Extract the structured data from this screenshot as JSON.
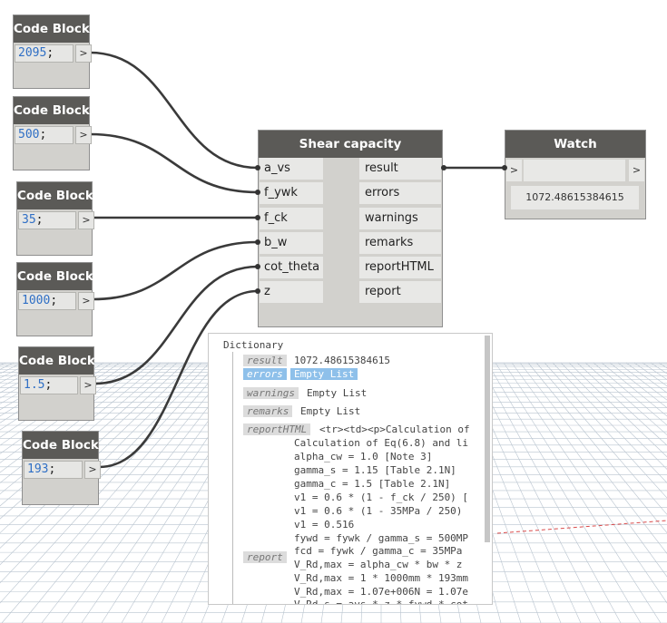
{
  "code_blocks": [
    {
      "title": "Code Block",
      "number": "2095",
      "suffix": ";",
      "out": ">"
    },
    {
      "title": "Code Block",
      "number": "500",
      "suffix": ";",
      "out": ">"
    },
    {
      "title": "Code Block",
      "number": "35",
      "suffix": ";",
      "out": ">"
    },
    {
      "title": "Code Block",
      "number": "1000",
      "suffix": ";",
      "out": ">"
    },
    {
      "title": "Code Block",
      "number": "1.5",
      "suffix": ";",
      "out": ">"
    },
    {
      "title": "Code Block",
      "number": "193",
      "suffix": ";",
      "out": ">"
    }
  ],
  "shear_node": {
    "title": "Shear capacity",
    "inputs": [
      "a_vs",
      "f_ywk",
      "f_ck",
      "b_w",
      "cot_theta",
      "z"
    ],
    "outputs": [
      "result",
      "errors",
      "warnings",
      "remarks",
      "reportHTML",
      "report"
    ]
  },
  "watch_node": {
    "title": "Watch",
    "in": ">",
    "out": ">",
    "value": "1072.48615384615"
  },
  "dictionary": {
    "title": "Dictionary",
    "result_key": "result",
    "result_value": "1072.48615384615",
    "errors_key": "errors",
    "errors_value": "Empty List",
    "warnings_key": "warnings",
    "warnings_value": "Empty List",
    "remarks_key": "remarks",
    "remarks_value": "Empty List",
    "reporthtml_key": "reportHTML",
    "report_key": "report",
    "report_lines": [
      "<tr><td><p>Calculation of",
      "Calculation of Eq(6.8) and li",
      "alpha_cw = 1.0 [Note 3]",
      "gamma_s = 1.15 [Table 2.1N]",
      "gamma_c = 1.5 [Table 2.1N]",
      "v1 = 0.6 * (1 - f_ck / 250) [",
      "v1 = 0.6 * (1 - 35MPa / 250)",
      "v1 = 0.516",
      "fywd = fywk / gamma_s = 500MP",
      "fcd = fywk / gamma_c = 35MPa",
      "V_Rd,max = alpha_cw * bw * z",
      "V_Rd,max = 1 * 1000mm * 193mm",
      "V_Rd,max = 1.07e+006N = 1.07e",
      "V_Rd,s = avs * z * fywd * cot"
    ]
  }
}
